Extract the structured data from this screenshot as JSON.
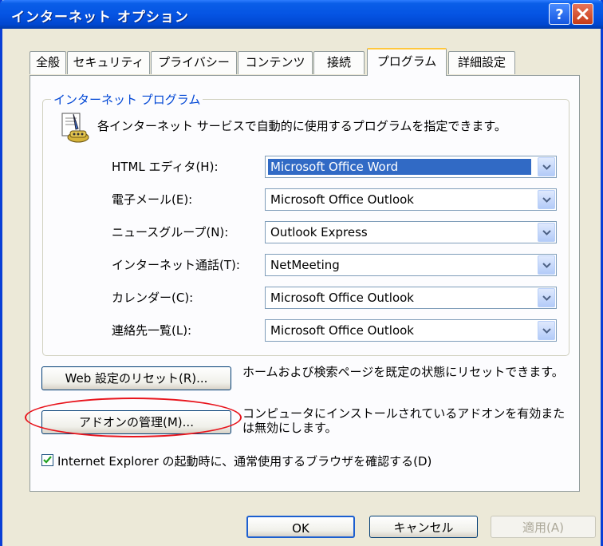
{
  "window": {
    "title": "インターネット オプション",
    "help_glyph": "?",
    "close_glyph": "✕"
  },
  "tabs": [
    {
      "label": "全般"
    },
    {
      "label": "セキュリティ"
    },
    {
      "label": "プライバシー"
    },
    {
      "label": "コンテンツ"
    },
    {
      "label": "接続"
    },
    {
      "label": "プログラム",
      "active": true
    },
    {
      "label": "詳細設定"
    }
  ],
  "programs_group": {
    "title": "インターネット プログラム",
    "description": "各インターネット サービスで自動的に使用するプログラムを指定できます。",
    "rows": [
      {
        "label": "HTML エディタ(H):",
        "value": "Microsoft Office Word"
      },
      {
        "label": "電子メール(E):",
        "value": "Microsoft Office Outlook"
      },
      {
        "label": "ニュースグループ(N):",
        "value": "Outlook Express"
      },
      {
        "label": "インターネット通話(T):",
        "value": "NetMeeting"
      },
      {
        "label": "カレンダー(C):",
        "value": "Microsoft Office Outlook"
      },
      {
        "label": "連絡先一覧(L):",
        "value": "Microsoft Office Outlook"
      }
    ]
  },
  "reset_web": {
    "button_label": "Web 設定のリセット(R)...",
    "description": "ホームおよび検索ページを既定の状態にリセットできます。"
  },
  "manage_addons": {
    "button_label": "アドオンの管理(M)...",
    "description": "コンピュータにインストールされているアドオンを有効または無効にします。"
  },
  "default_browser_check": {
    "label": "Internet Explorer の起動時に、通常使用するブラウザを確認する(D)",
    "checked": true
  },
  "footer": {
    "ok_label": "OK",
    "cancel_label": "キャンセル",
    "apply_label": "適用(A)"
  },
  "colors": {
    "titlebar": "#0554e3",
    "selection": "#316ac5",
    "group_title": "#0046d5",
    "highlight_ellipse": "#e8141c"
  }
}
